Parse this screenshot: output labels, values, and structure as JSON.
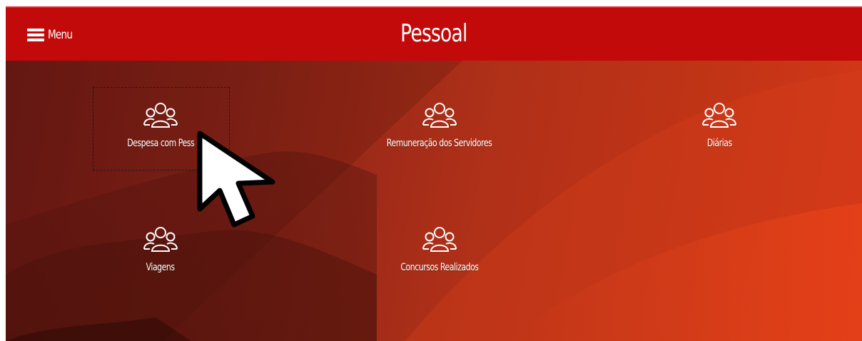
{
  "header": {
    "menu_label": "Menu",
    "title": "Pessoal",
    "background_color": "#c20a0a"
  },
  "tiles": [
    {
      "label": "Despesa com Pess",
      "icon": "users-icon",
      "focused": true
    },
    {
      "label": "Remuneração dos Servidores",
      "icon": "users-icon",
      "focused": false
    },
    {
      "label": "Diárias",
      "icon": "users-icon",
      "focused": false
    },
    {
      "label": "Viagens",
      "icon": "users-icon",
      "focused": false
    },
    {
      "label": "Concursos Realizados",
      "icon": "users-icon",
      "focused": false
    }
  ],
  "cursor": {
    "icon": "mouse-pointer-icon"
  }
}
